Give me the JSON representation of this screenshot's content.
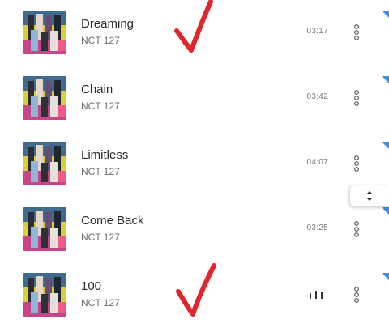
{
  "songs": [
    {
      "title": "Dreaming",
      "artist": "NCT 127",
      "duration": "03:17",
      "playing": false
    },
    {
      "title": "Chain",
      "artist": "NCT 127",
      "duration": "03:42",
      "playing": false
    },
    {
      "title": "Limitless",
      "artist": "NCT 127",
      "duration": "04:07",
      "playing": false
    },
    {
      "title": "Come Back",
      "artist": "NCT 127",
      "duration": "03:25",
      "playing": false
    },
    {
      "title": "100",
      "artist": "NCT 127",
      "duration": "",
      "playing": true
    }
  ],
  "icons": {
    "more": "more-vertical-icon",
    "playing": "equalizer-icon",
    "scroll": "scroll-handle-icon",
    "annotation": "red-checkmark"
  },
  "colors": {
    "checkmark": "#e0262b",
    "corner_marker": "#3c8ee6"
  }
}
